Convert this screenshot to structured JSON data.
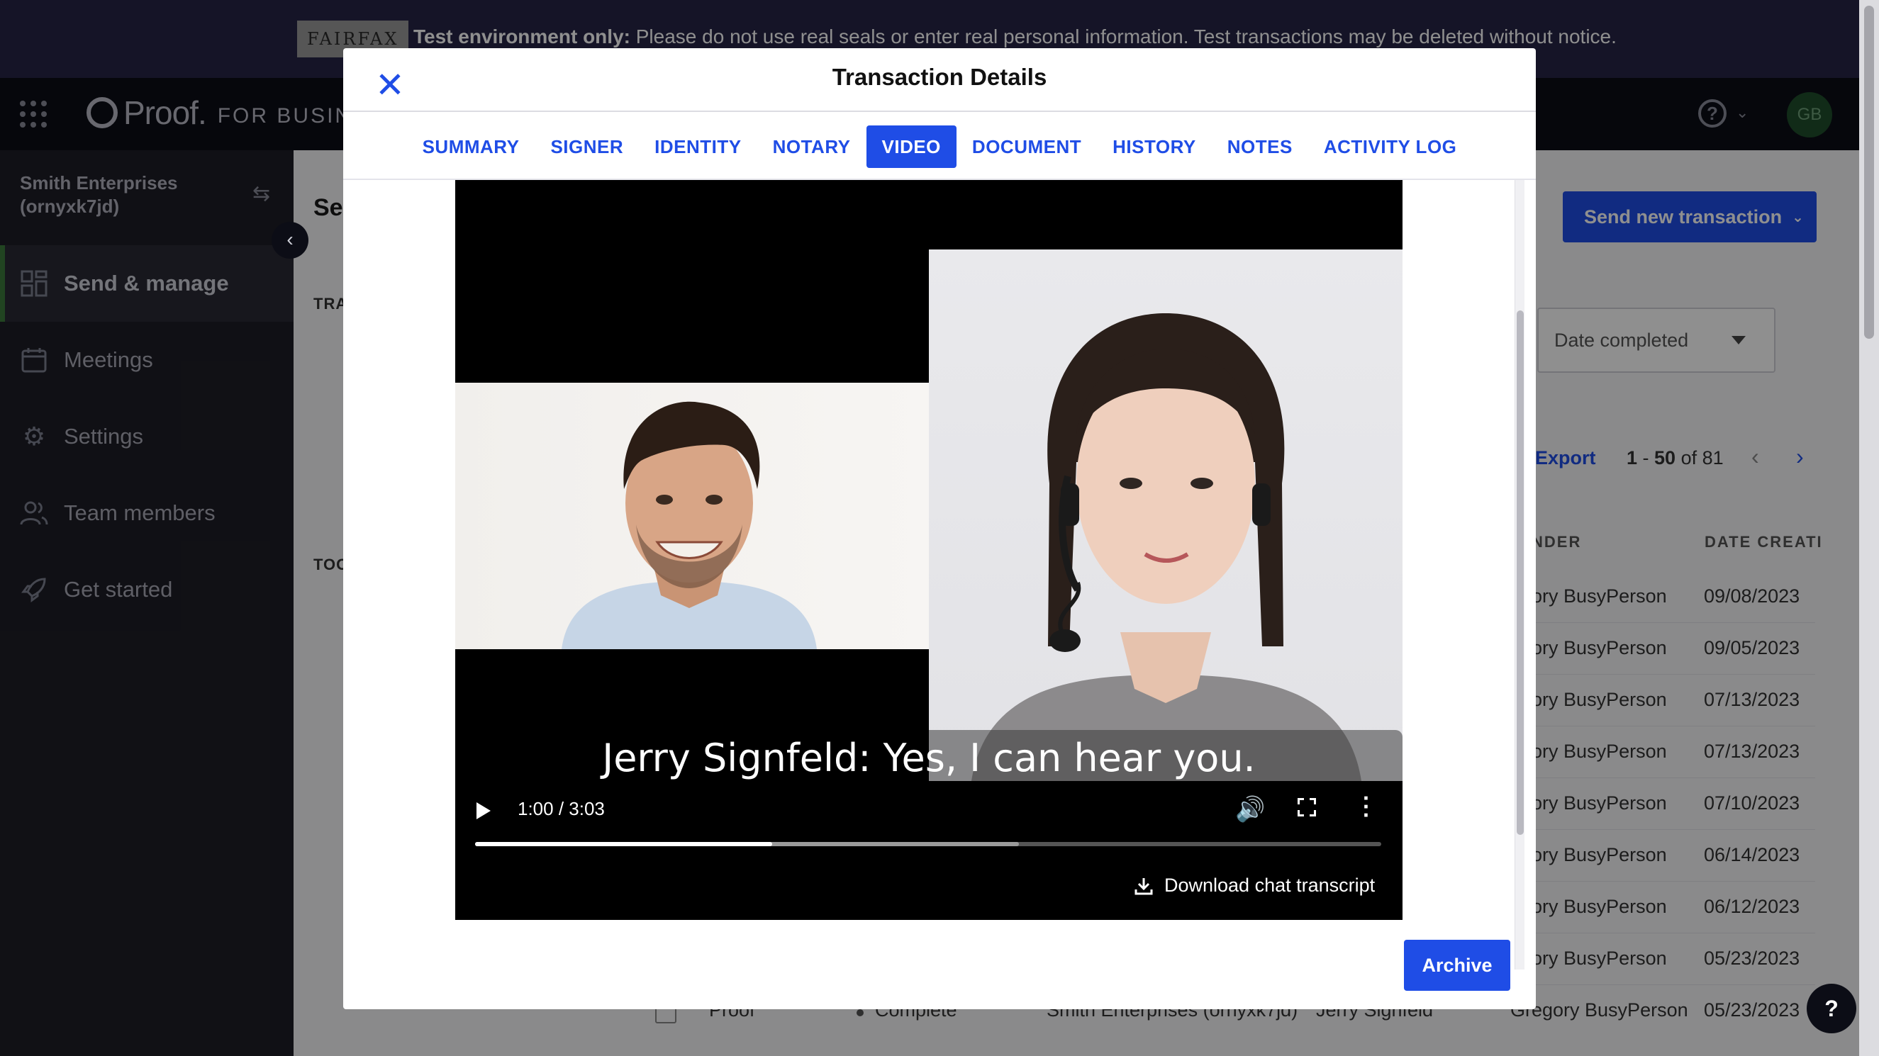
{
  "banner": {
    "badge": "FAIRFAX",
    "bold": "Test environment only:",
    "text": " Please do not use real seals or enter real personal information. Test transactions may be deleted without notice."
  },
  "header": {
    "logo_word": "Proof.",
    "logo_sub": "FOR BUSINESS",
    "help_symbol": "?",
    "avatar_initials": "GB",
    "icons": [
      "apps-grid-icon",
      "help-icon",
      "chevron-down-icon"
    ]
  },
  "sidebar": {
    "org_name": "Smith Enterprises",
    "org_id": "(ornyxk7jd)",
    "items": [
      {
        "label": "Send & manage",
        "icon": "dashboard-icon",
        "active": true
      },
      {
        "label": "Meetings",
        "icon": "calendar-icon",
        "active": false
      },
      {
        "label": "Settings",
        "icon": "gear-icon",
        "active": false
      },
      {
        "label": "Team members",
        "icon": "people-icon",
        "active": false
      },
      {
        "label": "Get started",
        "icon": "rocket-icon",
        "active": false
      }
    ]
  },
  "background_page": {
    "title_fragment": "Se",
    "section_fragments": [
      "TRA",
      "TOO"
    ],
    "send_button": "Send new transaction",
    "date_filter": "Date completed",
    "export": "Export",
    "pagination": {
      "start": "1",
      "sep": " - ",
      "end": "50",
      "of": " of ",
      "total": "81"
    },
    "column_headers": [
      "NDER",
      "DATE CREATI"
    ],
    "rows": [
      {
        "sender": "egory BusyPerson",
        "date": "09/08/2023"
      },
      {
        "sender": "egory BusyPerson",
        "date": "09/05/2023"
      },
      {
        "sender": "egory BusyPerson",
        "date": "07/13/2023"
      },
      {
        "sender": "egory BusyPerson",
        "date": "07/13/2023"
      },
      {
        "sender": "egory BusyPerson",
        "date": "07/10/2023"
      },
      {
        "sender": "egory BusyPerson",
        "date": "06/14/2023"
      },
      {
        "sender": "egory BusyPerson",
        "date": "06/12/2023"
      },
      {
        "sender": "egory BusyPerson",
        "date": "05/23/2023"
      }
    ],
    "last_row": {
      "platform": "Proof",
      "status": "Complete",
      "org": "Smith Enterprises (ornyxk7jd)",
      "signer": "Jerry Signfeld",
      "sender": "Gregory BusyPerson",
      "date": "05/23/2023"
    }
  },
  "modal": {
    "title": "Transaction Details",
    "tabs": [
      {
        "label": "SUMMARY",
        "active": false
      },
      {
        "label": "SIGNER",
        "active": false
      },
      {
        "label": "IDENTITY",
        "active": false
      },
      {
        "label": "NOTARY",
        "active": false
      },
      {
        "label": "VIDEO",
        "active": true
      },
      {
        "label": "DOCUMENT",
        "active": false
      },
      {
        "label": "HISTORY",
        "active": false
      },
      {
        "label": "NOTES",
        "active": false
      },
      {
        "label": "ACTIVITY LOG",
        "active": false
      }
    ],
    "video": {
      "caption": "Jerry Signfeld: Yes, I can hear you.",
      "time": "1:00 / 3:03",
      "played_fraction": 0.328,
      "buffered_fraction": 0.6,
      "download_label": "Download chat transcript"
    },
    "archive_button": "Archive"
  },
  "floating_help": "?"
}
